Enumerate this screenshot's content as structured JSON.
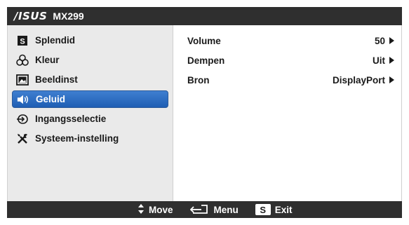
{
  "header": {
    "brand": "/ISUS",
    "model": "MX299"
  },
  "sidebar": {
    "items": [
      {
        "label": "Splendid",
        "icon": "splendid-s-icon",
        "selected": false
      },
      {
        "label": "Kleur",
        "icon": "color-circles-icon",
        "selected": false
      },
      {
        "label": "Beeldinst",
        "icon": "picture-icon",
        "selected": false
      },
      {
        "label": "Geluid",
        "icon": "speaker-icon",
        "selected": true
      },
      {
        "label": "Ingangsselectie",
        "icon": "input-arrow-icon",
        "selected": false
      },
      {
        "label": "Systeem-instelling",
        "icon": "tools-icon",
        "selected": false
      }
    ]
  },
  "content": {
    "rows": [
      {
        "name": "Volume",
        "value": "50"
      },
      {
        "name": "Dempen",
        "value": "Uit"
      },
      {
        "name": "Bron",
        "value": "DisplayPort"
      }
    ]
  },
  "footer": {
    "move": "Move",
    "menu": "Menu",
    "exit_key": "S",
    "exit": "Exit"
  },
  "colors": {
    "bar": "#2f2f2f",
    "sidebar": "#eaeaea",
    "selected": "#2563b7"
  }
}
